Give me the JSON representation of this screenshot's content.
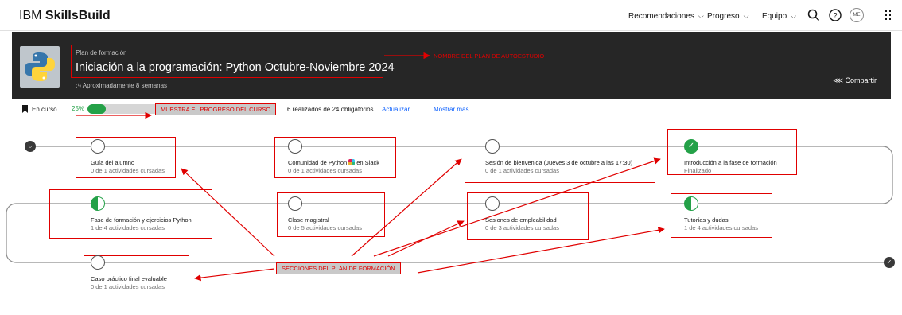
{
  "brand": {
    "prefix": "IBM",
    "name": "SkillsBuild"
  },
  "nav": {
    "items": [
      {
        "label": "Recomendaciones"
      },
      {
        "label": "Progreso"
      },
      {
        "label": "Equipo"
      }
    ],
    "avatar_initials": "ME"
  },
  "hero": {
    "eyebrow": "Plan de formación",
    "title": "Iniciación a la programación: Python Octubre-Noviembre 2024",
    "duration": "Aproximadamente 8 semanas",
    "share_label": "Compartir"
  },
  "progress": {
    "status": "En curso",
    "percent_label": "25%",
    "percent": 25,
    "done_text": "6 realizados de 24 obligatorios",
    "update_link": "Actualizar",
    "more_link": "Mostrar más"
  },
  "annotations": {
    "plan_name": "NOMBRE DEL PLAN DE AUTOESTUDIO",
    "progress": "MUESTRA EL PROGRESO DEL CURSO",
    "sections": "SECCIONES DEL PLAN DE FORMACIÓN"
  },
  "sections": [
    {
      "title": "Guía del alumno",
      "sub": "0 de 1 actividades cursadas",
      "state": "empty"
    },
    {
      "title": "Comunidad de Python",
      "title_suffix": "en Slack",
      "sub": "0 de 1 actividades cursadas",
      "state": "empty"
    },
    {
      "title": "Sesión de bienvenida (Jueves 3 de octubre a las 17:30)",
      "sub": "0 de 1 actividades cursadas",
      "state": "empty"
    },
    {
      "title": "Introducción a la fase de formación",
      "sub": "Finalizado",
      "state": "done"
    },
    {
      "title": "Fase de formación y ejercicios Python",
      "sub": "1 de 4 actividades cursadas",
      "state": "half"
    },
    {
      "title": "Clase magistral",
      "sub": "0 de 5 actividades cursadas",
      "state": "empty"
    },
    {
      "title": "Sesiones de empleabilidad",
      "sub": "0 de 3 actividades cursadas",
      "state": "empty"
    },
    {
      "title": "Tutorías y dudas",
      "sub": "1 de 4 actividades cursadas",
      "state": "half"
    },
    {
      "title": "Caso práctico final evaluable",
      "sub": "0 de 1 actividades cursadas",
      "state": "empty"
    }
  ],
  "colors": {
    "accent_green": "#24a148",
    "annotation_red": "#e00000",
    "hero_bg": "#262626",
    "link_blue": "#0f62fe"
  }
}
